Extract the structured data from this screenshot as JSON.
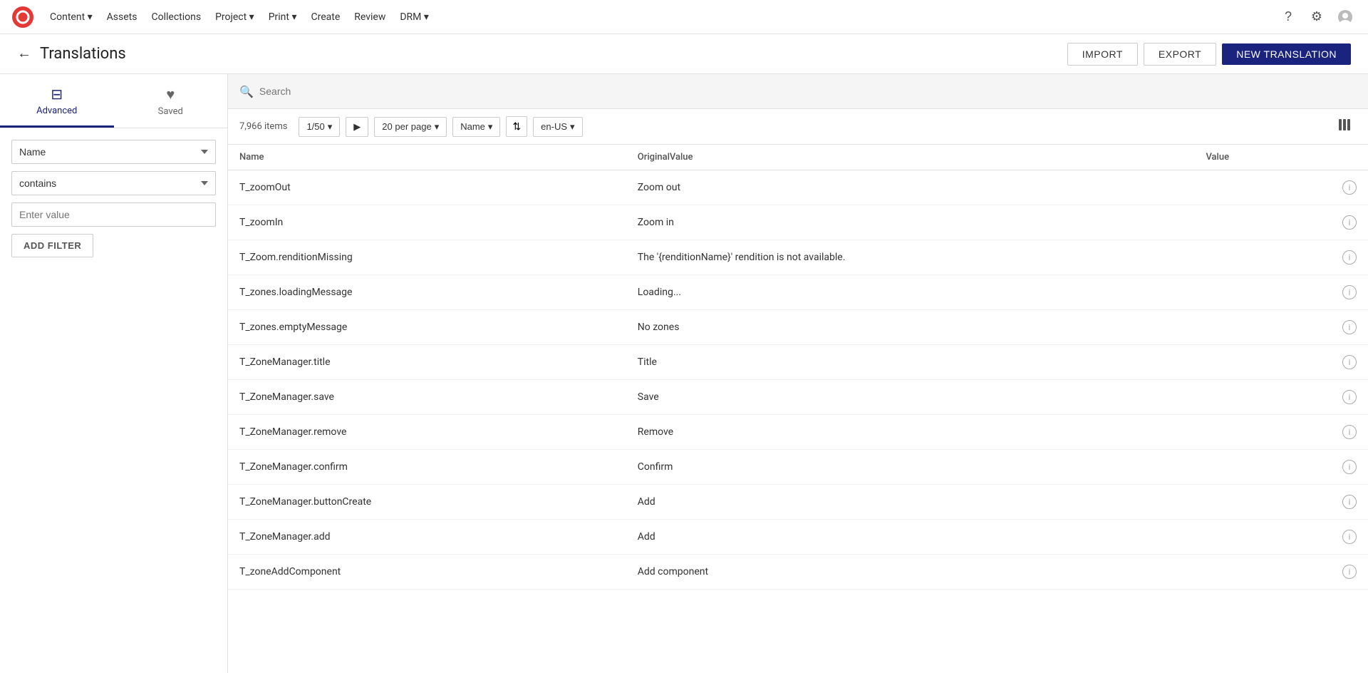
{
  "nav": {
    "items": [
      {
        "label": "Content",
        "hasDropdown": true
      },
      {
        "label": "Assets",
        "hasDropdown": false
      },
      {
        "label": "Collections",
        "hasDropdown": false
      },
      {
        "label": "Project",
        "hasDropdown": true
      },
      {
        "label": "Print",
        "hasDropdown": true
      },
      {
        "label": "Create",
        "hasDropdown": false
      },
      {
        "label": "Review",
        "hasDropdown": false
      },
      {
        "label": "DRM",
        "hasDropdown": true
      }
    ],
    "icons": {
      "help": "?",
      "settings": "⚙",
      "user": "👤"
    }
  },
  "header": {
    "title": "Translations",
    "back_label": "←",
    "import_label": "IMPORT",
    "export_label": "EXPORT",
    "new_translation_label": "NEW TRANSLATION"
  },
  "sidebar": {
    "tabs": [
      {
        "label": "Advanced",
        "icon": "≡",
        "active": true
      },
      {
        "label": "Saved",
        "icon": "♥",
        "active": false
      }
    ],
    "filter": {
      "name_select_value": "Name",
      "condition_select_value": "contains",
      "value_placeholder": "Enter value",
      "add_filter_label": "ADD FILTER"
    }
  },
  "search": {
    "placeholder": "Search"
  },
  "toolbar": {
    "items_count": "7,966 items",
    "pagination": "1/50",
    "per_page": "20 per page",
    "sort_by": "Name",
    "locale": "en-US"
  },
  "table": {
    "columns": [
      {
        "label": "Name"
      },
      {
        "label": "OriginalValue"
      },
      {
        "label": "Value"
      },
      {
        "label": ""
      }
    ],
    "rows": [
      {
        "name": "T_zoomOut",
        "originalValue": "Zoom out",
        "value": ""
      },
      {
        "name": "T_zoomIn",
        "originalValue": "Zoom in",
        "value": ""
      },
      {
        "name": "T_Zoom.renditionMissing",
        "originalValue": "The '{renditionName}' rendition is not available.",
        "value": ""
      },
      {
        "name": "T_zones.loadingMessage",
        "originalValue": "Loading...",
        "value": ""
      },
      {
        "name": "T_zones.emptyMessage",
        "originalValue": "No zones",
        "value": ""
      },
      {
        "name": "T_ZoneManager.title",
        "originalValue": "Title",
        "value": ""
      },
      {
        "name": "T_ZoneManager.save",
        "originalValue": "Save",
        "value": ""
      },
      {
        "name": "T_ZoneManager.remove",
        "originalValue": "Remove",
        "value": ""
      },
      {
        "name": "T_ZoneManager.confirm",
        "originalValue": "Confirm",
        "value": ""
      },
      {
        "name": "T_ZoneManager.buttonCreate",
        "originalValue": "Add",
        "value": ""
      },
      {
        "name": "T_ZoneManager.add",
        "originalValue": "Add",
        "value": ""
      },
      {
        "name": "T_zoneAddComponent",
        "originalValue": "Add component",
        "value": ""
      }
    ]
  }
}
